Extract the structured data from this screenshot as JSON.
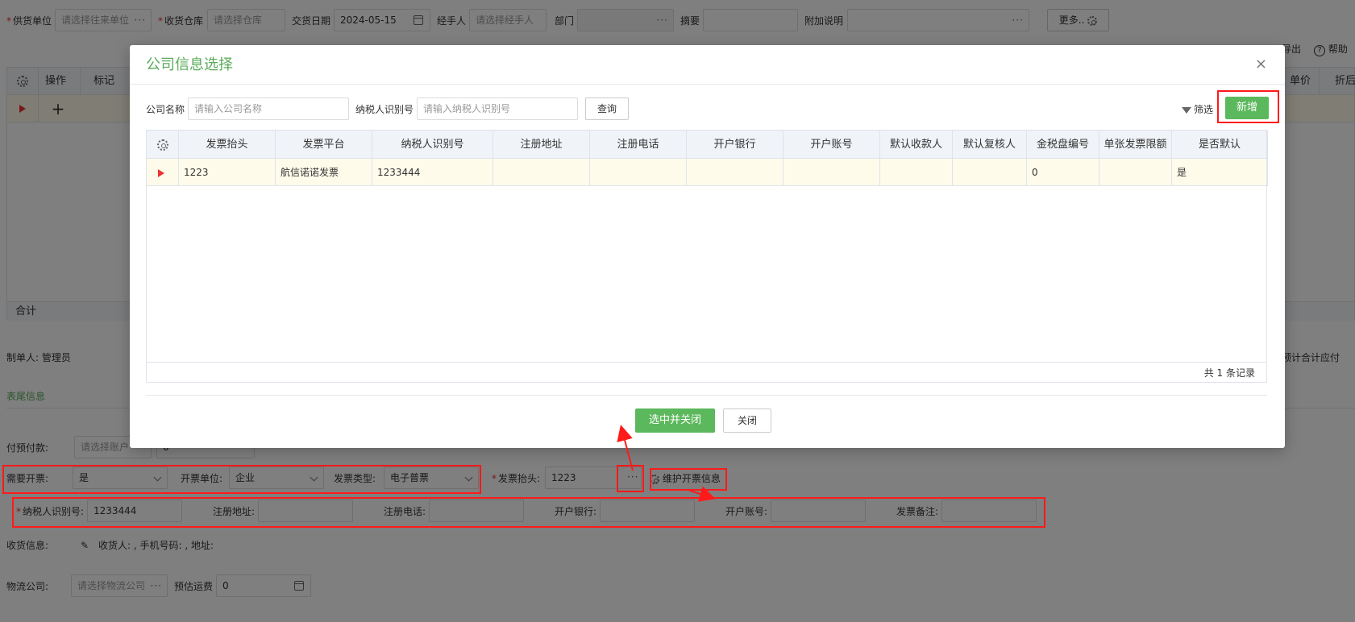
{
  "top_form": {
    "supplier_label": "供货单位",
    "supplier_placeholder": "请选择往来单位",
    "warehouse_label": "收货仓库",
    "warehouse_placeholder": "请选择仓库",
    "date_label": "交货日期",
    "date_value": "2024-05-15",
    "handler_label": "经手人",
    "handler_placeholder": "请选择经手人",
    "dept_label": "部门",
    "summary_label": "摘要",
    "note_label": "附加说明",
    "more_label": "更多..",
    "export_label": "导出",
    "help_label": "帮助"
  },
  "bg_table": {
    "col_ops": "操作",
    "col_mark": "标记",
    "col_price": "单价",
    "col_discount": "折后",
    "add_symbol": "+",
    "total_label": "合计"
  },
  "bg_mid": {
    "maker_label": "制单人: 管理员",
    "estimate_label": "预计合计应付",
    "tab_footer": "表尾信息",
    "prepay_label": "付预付款:",
    "prepay_placeholder": "请选择账户",
    "prepay_amount": "0"
  },
  "invoice_row": {
    "need_label": "需要开票:",
    "need_value": "是",
    "unit_label": "开票单位:",
    "unit_value": "企业",
    "type_label": "发票类型:",
    "type_value": "电子普票",
    "header_label": "发票抬头:",
    "header_value": "1223",
    "maintain_label": "维护开票信息"
  },
  "tax_row": {
    "taxno_label": "纳税人识别号:",
    "taxno_value": "1233444",
    "addr_label": "注册地址:",
    "phone_label": "注册电话:",
    "bank_label": "开户银行:",
    "account_label": "开户账号:",
    "remark_label": "发票备注:"
  },
  "receive_row": {
    "label": "收货信息:",
    "text": "收货人: , 手机号码: , 地址:"
  },
  "logistics_row": {
    "company_label": "物流公司:",
    "company_placeholder": "请选择物流公司",
    "freight_label": "预估运费",
    "freight_value": "0"
  },
  "modal": {
    "title": "公司信息选择",
    "close_symbol": "×",
    "company_label": "公司名称",
    "company_placeholder": "请输入公司名称",
    "taxno_label": "纳税人识别号",
    "taxno_placeholder": "请输入纳税人识别号",
    "query_label": "查询",
    "filter_label": "筛选",
    "add_label": "新增",
    "columns": [
      "发票抬头",
      "发票平台",
      "纳税人识别号",
      "注册地址",
      "注册电话",
      "开户银行",
      "开户账号",
      "默认收款人",
      "默认复核人",
      "金税盘编号",
      "单张发票限额",
      "是否默认"
    ],
    "rows": [
      [
        "1223",
        "航信诺诺发票",
        "1233444",
        "",
        "",
        "",
        "",
        "",
        "",
        "0",
        "",
        "是"
      ]
    ],
    "total_records": "共 1 条记录",
    "confirm_label": "选中并关闭",
    "cancel_label": "关闭"
  },
  "colors": {
    "accent_green": "#5cb85c",
    "title_green": "#5aab5a",
    "annotation_red": "#ff1a1a"
  }
}
